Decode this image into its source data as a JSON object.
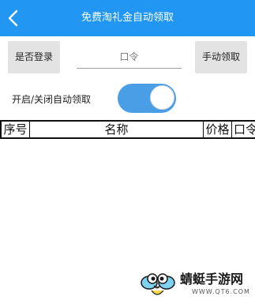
{
  "header": {
    "title": "免费淘礼金自动领取",
    "back_icon": "chevron-left-icon",
    "background_color": "#2196f3"
  },
  "actions": {
    "login_button_label": "是否登录",
    "code_input_placeholder": "口令",
    "code_input_value": "",
    "manual_button_label": "手动领取"
  },
  "auto_claim": {
    "label": "开启/关闭自动领取",
    "enabled": true,
    "switch_color": "#4a9ee6"
  },
  "table": {
    "columns": [
      "序号",
      "名称",
      "价格",
      "口令"
    ],
    "rows": []
  },
  "watermark": {
    "brand": "蜻蜓手游网",
    "url": "WWW.QT6.COM"
  }
}
